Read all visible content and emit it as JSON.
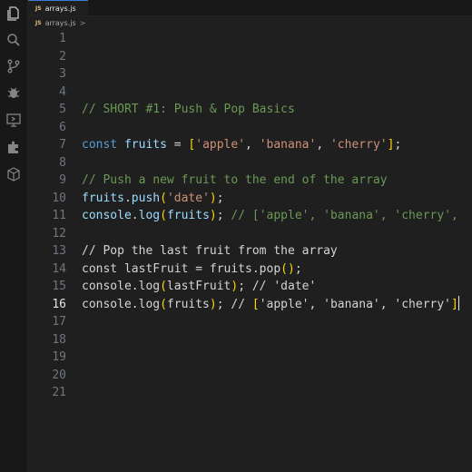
{
  "tab": {
    "badge": "JS",
    "label": "arrays.js"
  },
  "breadcrumb": {
    "badge": "JS",
    "file": "arrays.js",
    "chevron": ">"
  },
  "activity_icons": [
    "files-icon",
    "search-icon",
    "source-control-icon",
    "debug-icon",
    "remote-explorer-icon",
    "extensions-icon",
    "package-icon"
  ],
  "colors": {
    "comment": "#6a9955",
    "keyword": "#569cd6",
    "variable": "#9cdcfe",
    "string": "#ce9178",
    "bracket": "#ffd700",
    "active_line_number": "#e6e6e6"
  },
  "active_line": 16,
  "lines": [
    {
      "n": "1",
      "tokens": []
    },
    {
      "n": "2",
      "tokens": []
    },
    {
      "n": "3",
      "tokens": []
    },
    {
      "n": "4",
      "tokens": []
    },
    {
      "n": "5",
      "tokens": [
        {
          "t": "// SHORT #1: Push & Pop Basics",
          "c": "comment"
        }
      ]
    },
    {
      "n": "6",
      "tokens": []
    },
    {
      "n": "7",
      "tokens": [
        {
          "t": "const ",
          "c": "keyword"
        },
        {
          "t": "fruits",
          "c": "var"
        },
        {
          "t": " = ",
          "c": "default"
        },
        {
          "t": "[",
          "c": "bracket"
        },
        {
          "t": "'apple'",
          "c": "string"
        },
        {
          "t": ", ",
          "c": "default"
        },
        {
          "t": "'banana'",
          "c": "string"
        },
        {
          "t": ", ",
          "c": "default"
        },
        {
          "t": "'cherry'",
          "c": "string"
        },
        {
          "t": "]",
          "c": "bracket"
        },
        {
          "t": ";",
          "c": "default"
        }
      ]
    },
    {
      "n": "8",
      "tokens": []
    },
    {
      "n": "9",
      "tokens": [
        {
          "t": "// Push a new fruit to the end of the array",
          "c": "comment"
        }
      ]
    },
    {
      "n": "10",
      "tokens": [
        {
          "t": "fruits",
          "c": "var"
        },
        {
          "t": ".",
          "c": "default"
        },
        {
          "t": "push",
          "c": "var"
        },
        {
          "t": "(",
          "c": "bracket"
        },
        {
          "t": "'date'",
          "c": "string"
        },
        {
          "t": ")",
          "c": "bracket"
        },
        {
          "t": ";",
          "c": "default"
        }
      ]
    },
    {
      "n": "11",
      "tokens": [
        {
          "t": "console",
          "c": "var"
        },
        {
          "t": ".",
          "c": "default"
        },
        {
          "t": "log",
          "c": "var"
        },
        {
          "t": "(",
          "c": "bracket"
        },
        {
          "t": "fruits",
          "c": "var"
        },
        {
          "t": ")",
          "c": "bracket"
        },
        {
          "t": "; ",
          "c": "default"
        },
        {
          "t": "// ['apple', 'banana', 'cherry',",
          "c": "comment"
        }
      ]
    },
    {
      "n": "12",
      "tokens": []
    },
    {
      "n": "13",
      "tokens": [
        {
          "t": "// Pop the last fruit from the array",
          "c": "default"
        }
      ]
    },
    {
      "n": "14",
      "tokens": [
        {
          "t": "const lastFruit = fruits.pop",
          "c": "default"
        },
        {
          "t": "()",
          "c": "bracket"
        },
        {
          "t": ";",
          "c": "default"
        }
      ]
    },
    {
      "n": "15",
      "tokens": [
        {
          "t": "console.log",
          "c": "default"
        },
        {
          "t": "(",
          "c": "bracket"
        },
        {
          "t": "lastFruit",
          "c": "default"
        },
        {
          "t": ")",
          "c": "bracket"
        },
        {
          "t": "; // 'date'",
          "c": "default"
        }
      ]
    },
    {
      "n": "16",
      "tokens": [
        {
          "t": "console.log",
          "c": "default"
        },
        {
          "t": "(",
          "c": "bracket"
        },
        {
          "t": "fruits",
          "c": "default"
        },
        {
          "t": ")",
          "c": "bracket"
        },
        {
          "t": "; // ",
          "c": "default"
        },
        {
          "t": "[",
          "c": "bracket"
        },
        {
          "t": "'apple', 'banana', 'cherry'",
          "c": "default"
        },
        {
          "t": "]",
          "c": "bracket"
        }
      ],
      "cursor": true
    },
    {
      "n": "17",
      "tokens": []
    },
    {
      "n": "18",
      "tokens": []
    },
    {
      "n": "19",
      "tokens": []
    },
    {
      "n": "20",
      "tokens": []
    },
    {
      "n": "21",
      "tokens": []
    }
  ]
}
